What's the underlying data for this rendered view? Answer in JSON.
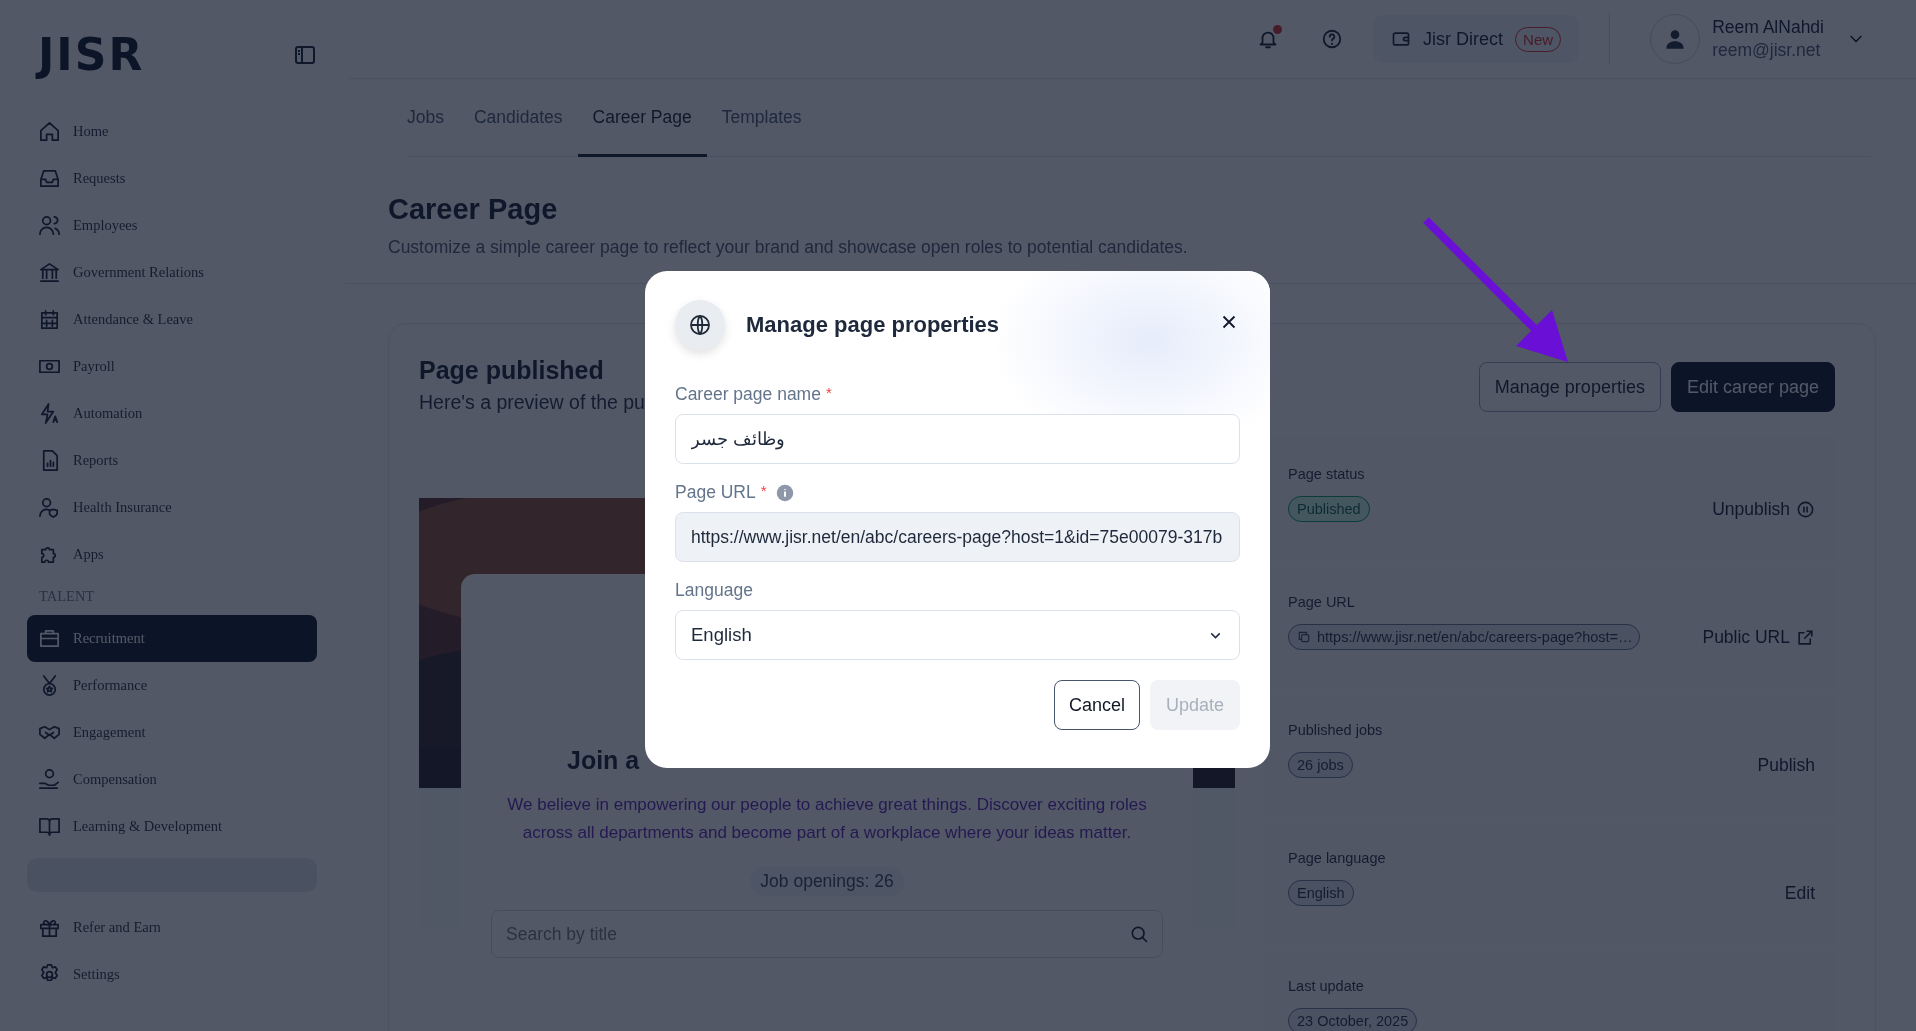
{
  "logo": "JISR",
  "sidebar": {
    "items": [
      {
        "label": "Home",
        "selected": false
      },
      {
        "label": "Requests",
        "selected": false
      },
      {
        "label": "Employees",
        "selected": false
      },
      {
        "label": "Government Relations",
        "selected": false
      },
      {
        "label": "Attendance & Leave",
        "selected": false
      },
      {
        "label": "Payroll",
        "selected": false
      },
      {
        "label": "Automation",
        "selected": false
      },
      {
        "label": "Reports",
        "selected": false
      },
      {
        "label": "Health Insurance",
        "selected": false
      },
      {
        "label": "Apps",
        "selected": false
      }
    ],
    "section_label": "TALENT",
    "talent_items": [
      {
        "label": "Recruitment",
        "selected": true
      },
      {
        "label": "Performance",
        "selected": false
      },
      {
        "label": "Engagement",
        "selected": false
      },
      {
        "label": "Compensation",
        "selected": false
      },
      {
        "label": "Learning & Development",
        "selected": false
      }
    ],
    "footer_items": [
      {
        "label": "Refer and Earn",
        "selected": false
      },
      {
        "label": "Settings",
        "selected": false
      }
    ]
  },
  "header": {
    "notifications_unread": true,
    "direct": {
      "label": "Jisr Direct",
      "badge": "New"
    },
    "user": {
      "name": "Reem AlNahdi",
      "email": "reem@jisr.net"
    }
  },
  "tabs": [
    {
      "label": "Jobs",
      "selected": false
    },
    {
      "label": "Candidates",
      "selected": false
    },
    {
      "label": "Career Page",
      "selected": true
    },
    {
      "label": "Templates",
      "selected": false
    }
  ],
  "page": {
    "title": "Career Page",
    "subtitle": "Customize a simple career page to reflect your brand and showcase open roles to potential candidates."
  },
  "preview": {
    "title": "Page published",
    "subtitle": "Here's a preview of the pu",
    "heading": "Join a",
    "description": "We believe in empowering our people to achieve great things. Discover exciting roles across all departments and become part of a workplace where your ideas matter.",
    "openings": "Job openings: 26",
    "search_placeholder": "Search by title"
  },
  "actions": [
    "Manage properties",
    "Edit career page"
  ],
  "details": [
    {
      "kind": "status",
      "label": "Page status",
      "value": "Published",
      "action": "Unpublish"
    },
    {
      "kind": "url",
      "label": "Page URL",
      "value": "https://www.jisr.net/en/abc/careers-page?host=…",
      "action": "Public URL"
    },
    {
      "kind": "plain",
      "label": "Published jobs",
      "value": "26 jobs",
      "action": "Publish"
    },
    {
      "kind": "plain",
      "label": "Page language",
      "value": "English",
      "action": "Edit"
    },
    {
      "kind": "plain",
      "label": "Last update",
      "value": "23 October, 2025"
    }
  ],
  "modal": {
    "title": "Manage page properties",
    "fields": [
      {
        "kind": "text",
        "label": "Career page name",
        "required_mark": "*",
        "value": "وظائف جسر"
      },
      {
        "kind": "text",
        "label": "Page URL",
        "required_mark": "*",
        "info": true,
        "disabled": true,
        "value": "https://www.jisr.net/en/abc/careers-page?host=1&id=75e00079-317b"
      },
      {
        "kind": "select",
        "label": "Language",
        "value": "English"
      }
    ],
    "buttons": [
      {
        "label": "Cancel",
        "kind": "secondary",
        "disabled": false
      },
      {
        "label": "Update",
        "kind": "primary",
        "disabled": true
      }
    ]
  }
}
